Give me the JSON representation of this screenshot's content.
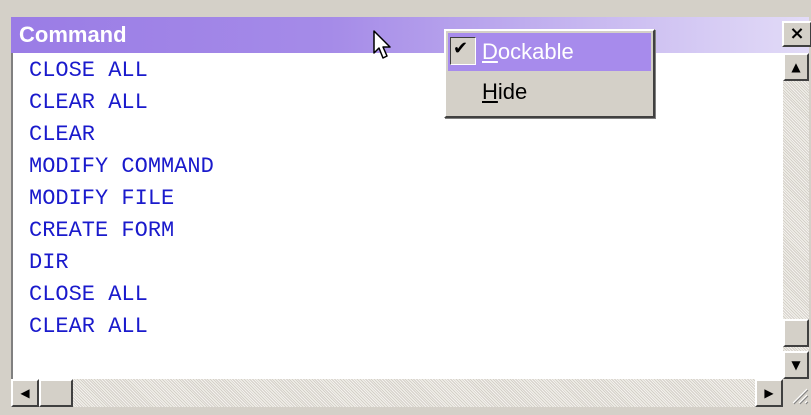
{
  "window": {
    "title": "Command",
    "close_label": "×"
  },
  "editor": {
    "lines": [
      "CLOSE ALL",
      "CLEAR ALL",
      "CLEAR",
      "MODIFY COMMAND",
      "MODIFY FILE",
      "CREATE FORM",
      "DIR",
      "CLOSE ALL",
      "CLEAR ALL"
    ],
    "text_color": "#1a1acc"
  },
  "context_menu": {
    "items": [
      {
        "hotkey": "D",
        "rest": "ockable",
        "checked": true,
        "selected": true
      },
      {
        "hotkey": "H",
        "rest": "ide",
        "checked": false,
        "selected": false
      }
    ],
    "check_glyph": "✔",
    "highlight_color": "#a78bec"
  },
  "scrollbars": {
    "up_arrow": "▲",
    "down_arrow": "▼",
    "left_arrow": "◀",
    "right_arrow": "▶"
  },
  "colors": {
    "titlebar_start": "#9a7ce6",
    "titlebar_end": "#e2dbf7",
    "face": "#d4d0c8"
  },
  "icons": [
    "close-icon",
    "check-icon",
    "mouse-pointer-icon",
    "scroll-up-icon",
    "scroll-down-icon",
    "scroll-left-icon",
    "scroll-right-icon",
    "resize-grip-icon"
  ]
}
